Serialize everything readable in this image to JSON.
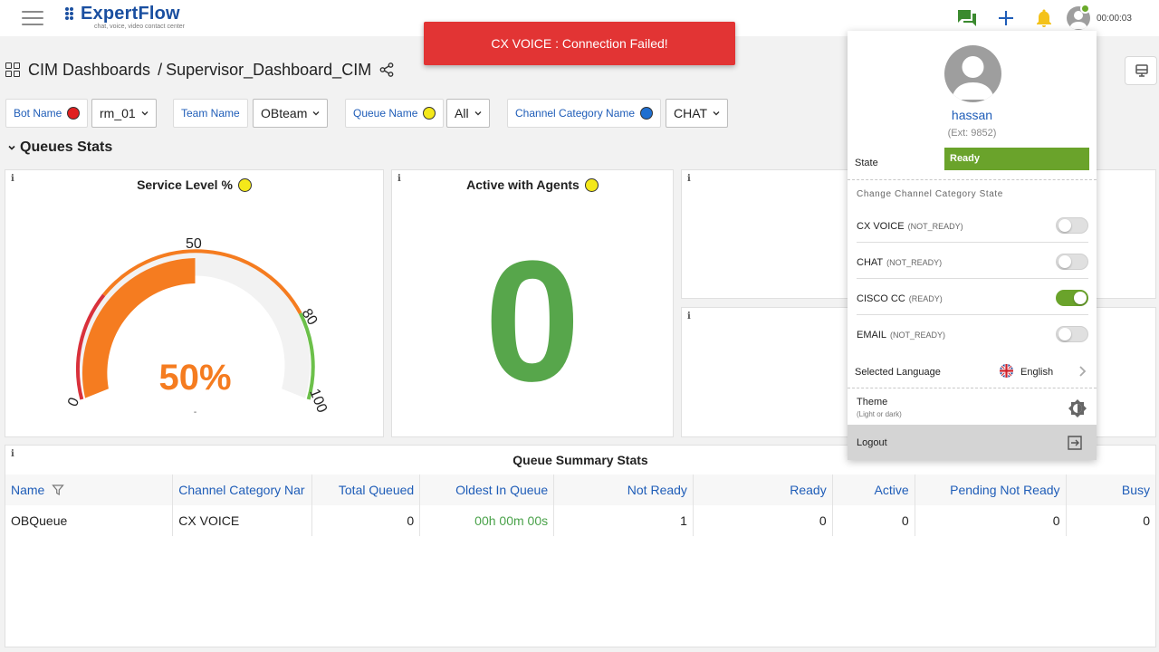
{
  "colors": {
    "accent": "#1f5db8",
    "toast_bg": "#e23434",
    "ready_green": "#6aa32b",
    "zero_green": "#57a64b",
    "gauge_orange": "#f57c20",
    "gauge_red": "#d9313b",
    "gauge_green": "#6cc04a"
  },
  "header": {
    "logo_text": "ExpertFlow",
    "logo_tagline": "chat, voice, video contact center",
    "timer": "00:00:03",
    "icons": [
      "menu-icon",
      "chat-icon",
      "plus-icon",
      "bell-icon",
      "user-icon"
    ]
  },
  "toast": {
    "message": "CX VOICE : Connection Failed!"
  },
  "breadcrumb": {
    "root": "CIM Dashboards",
    "separator": "/",
    "current": "Supervisor_Dashboard_CIM"
  },
  "filters": {
    "bot": {
      "label": "Bot Name",
      "dot_color": "#e02020",
      "value": "rm_01"
    },
    "team": {
      "label": "Team Name",
      "value": "OBteam"
    },
    "queue": {
      "label": "Queue Name",
      "dot_color": "#f4e81a",
      "value": "All"
    },
    "channel": {
      "label": "Channel Category Name",
      "dot_color": "#1f6fd0",
      "value": "CHAT"
    }
  },
  "section": {
    "title": "Queues Stats"
  },
  "cards": {
    "info_glyph": "i",
    "service_level": {
      "title": "Service Level %",
      "value_text": "50%",
      "value": 50,
      "tick_labels": [
        "0",
        "50",
        "80",
        "100"
      ],
      "footer": "-"
    },
    "active_agents": {
      "title": "Active with Agents",
      "value": "0"
    }
  },
  "queue_summary": {
    "title": "Queue Summary Stats",
    "columns": [
      "Name",
      "Channel Category Nar",
      "Total Queued",
      "Oldest In Queue",
      "Not Ready",
      "Ready",
      "Active",
      "Pending Not Ready",
      "Busy"
    ],
    "rows": [
      [
        "OBQueue",
        "CX VOICE",
        "0",
        "00h 00m 00s",
        "1",
        "0",
        "0",
        "0",
        "0"
      ]
    ]
  },
  "profile": {
    "username": "hassan",
    "ext": "(Ext: 9852)",
    "state_label": "State",
    "state_value": "Ready",
    "channel_section_title": "Change Channel Category State",
    "channels": [
      {
        "name": "CX VOICE",
        "state": "(NOT_READY)",
        "on": false
      },
      {
        "name": "CHAT",
        "state": "(NOT_READY)",
        "on": false
      },
      {
        "name": "CISCO CC",
        "state": "(READY)",
        "on": true
      },
      {
        "name": "EMAIL",
        "state": "(NOT_READY)",
        "on": false
      }
    ],
    "language_label": "Selected Language",
    "language_value": "English",
    "theme_label": "Theme",
    "theme_sub": "(Light or dark)",
    "logout_label": "Logout"
  }
}
